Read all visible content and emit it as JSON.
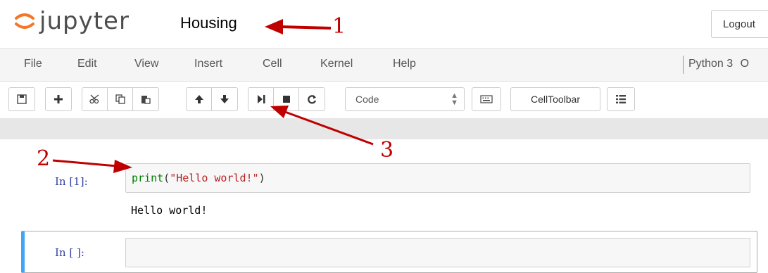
{
  "header": {
    "logo_text": "jupyter",
    "notebook_name": "Housing",
    "logout_label": "Logout"
  },
  "menubar": {
    "items": [
      {
        "label": "File"
      },
      {
        "label": "Edit"
      },
      {
        "label": "View"
      },
      {
        "label": "Insert"
      },
      {
        "label": "Cell"
      },
      {
        "label": "Kernel"
      },
      {
        "label": "Help"
      }
    ],
    "kernel_name": "Python 3",
    "kernel_indicator": "O"
  },
  "toolbar": {
    "icons": [
      "save-icon",
      "plus-icon",
      "cut-icon",
      "copy-icon",
      "paste-icon",
      "arrow-up-icon",
      "arrow-down-icon",
      "run-icon",
      "stop-icon",
      "restart-icon",
      "keyboard-icon",
      "list-icon"
    ],
    "cell_type_value": "Code",
    "celltoolbar_label": "CellToolbar"
  },
  "cells": [
    {
      "prompt": "In [1]:",
      "code_builtin": "print",
      "code_open": "(",
      "code_string": "\"Hello world!\"",
      "code_close": ")",
      "output": "Hello world!"
    },
    {
      "prompt": "In [ ]:",
      "code": ""
    }
  ],
  "annotations": {
    "label_1": "1",
    "label_2": "2",
    "label_3": "3",
    "arrow_color": "#c00000"
  },
  "colors": {
    "logo_orange": "#f37726",
    "prompt_blue": "#303f9f",
    "selected_border": "#42a5f5",
    "builtin_green": "#008000",
    "string_red": "#ba2121"
  }
}
